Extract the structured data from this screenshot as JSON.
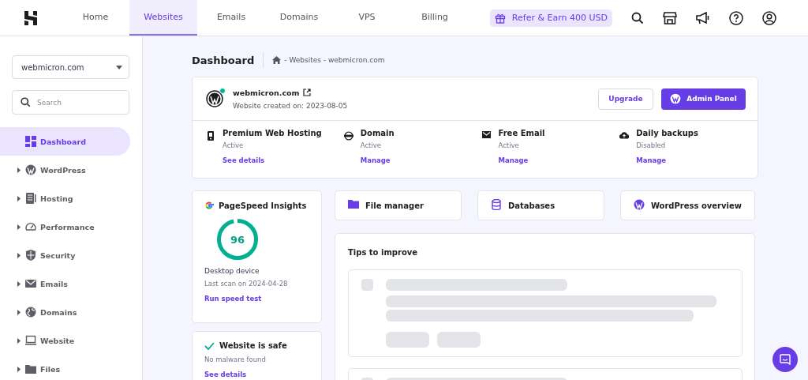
{
  "top_nav": {
    "tabs": [
      {
        "label": "Home",
        "selected": false
      },
      {
        "label": "Websites",
        "selected": true
      },
      {
        "label": "Emails",
        "selected": false
      },
      {
        "label": "Domains",
        "selected": false
      },
      {
        "label": "VPS",
        "selected": false
      },
      {
        "label": "Billing",
        "selected": false
      }
    ],
    "refer_button": "Refer & Earn 400 USD"
  },
  "sidebar": {
    "site_select": "webmicron.com",
    "search": {
      "placeholder": "Search"
    },
    "items": [
      {
        "label": "Dashboard",
        "kind": "link",
        "selected": true
      },
      {
        "label": "WordPress",
        "kind": "group",
        "selected": false
      },
      {
        "label": "Hosting",
        "kind": "group",
        "selected": false
      },
      {
        "label": "Performance",
        "kind": "group",
        "selected": false
      },
      {
        "label": "Security",
        "kind": "group",
        "selected": false
      },
      {
        "label": "Emails",
        "kind": "group",
        "selected": false
      },
      {
        "label": "Domains",
        "kind": "group",
        "selected": false
      },
      {
        "label": "Website",
        "kind": "group",
        "selected": false
      },
      {
        "label": "Files",
        "kind": "group",
        "selected": false
      }
    ]
  },
  "header": {
    "title": "Dashboard",
    "breadcrumb": "- Websites - webmicron.com"
  },
  "site_card": {
    "domain": "webmicron.com",
    "online": true,
    "created": "Website created on: 2023-08-05",
    "buttons": [
      "Upgrade",
      "Admin Panel"
    ],
    "services": [
      {
        "name": "Premium Web Hosting",
        "status": "Active",
        "link": "See details"
      },
      {
        "name": "Domain",
        "status": "Active",
        "link": "Manage"
      },
      {
        "name": "Free Email",
        "status": "Active",
        "link": "Manage"
      },
      {
        "name": "Daily backups",
        "status": "Disabled",
        "link": "Manage"
      }
    ]
  },
  "pagespeed": {
    "title": "PageSpeed Insights",
    "score": "96",
    "level": 0.96,
    "device": "Desktop device",
    "last_scan": "Last scan on 2024-04-28",
    "link": "Run speed test"
  },
  "security": {
    "title": "Website is safe",
    "subtitle": "No malware found",
    "link": "See details"
  },
  "shortcuts": [
    "File manager",
    "Databases",
    "WordPress overview"
  ],
  "tips": {
    "title": "Tips to improve"
  }
}
